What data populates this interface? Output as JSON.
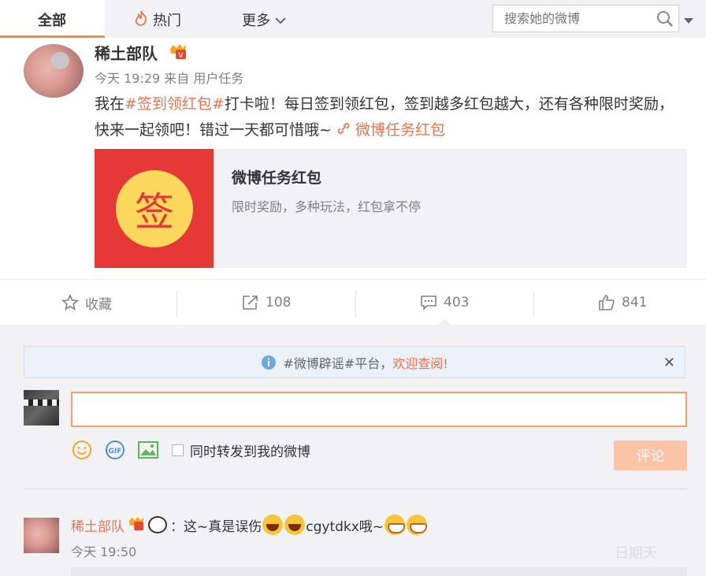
{
  "nav": {
    "tab_all": "全部",
    "tab_hot": "热门",
    "tab_more": "更多",
    "search_placeholder": "搜索她的微博"
  },
  "post": {
    "author": "稀土部队",
    "time": "今天 19:29",
    "source_prefix": "来自",
    "source": "用户任务",
    "text_before": "我在",
    "topic": "#签到领红包#",
    "text_after": "打卡啦！每日签到领红包，签到越多红包越大，还有各种限时奖励，快来一起领吧！错过一天都可惜哦~ ",
    "link_text": "微博任务红包",
    "card": {
      "seal_char": "签",
      "title": "微博任务红包",
      "desc": "限时奖励，多种玩法，红包拿不停"
    }
  },
  "actions": {
    "favorite_label": "收藏",
    "repost_count": "108",
    "comment_count": "403",
    "like_count": "841"
  },
  "comments": {
    "notice_topic": "#微博辟谣#平台，",
    "notice_highlight": "欢迎查阅!",
    "input_value": "",
    "repost_checkbox_label": "同时转发到我的微博",
    "submit_label": "评论",
    "items": [
      {
        "author": "稀土部队",
        "text_part1": "：这~真是误伤",
        "text_part2": "cgytdkx哦~",
        "time": "今天 19:50"
      }
    ]
  },
  "watermark": "日期天",
  "colors": {
    "accent": "#eb7350",
    "red_packet": "#e63837",
    "seal": "#fbd85b",
    "submit_disabled": "#fcc4a6"
  }
}
